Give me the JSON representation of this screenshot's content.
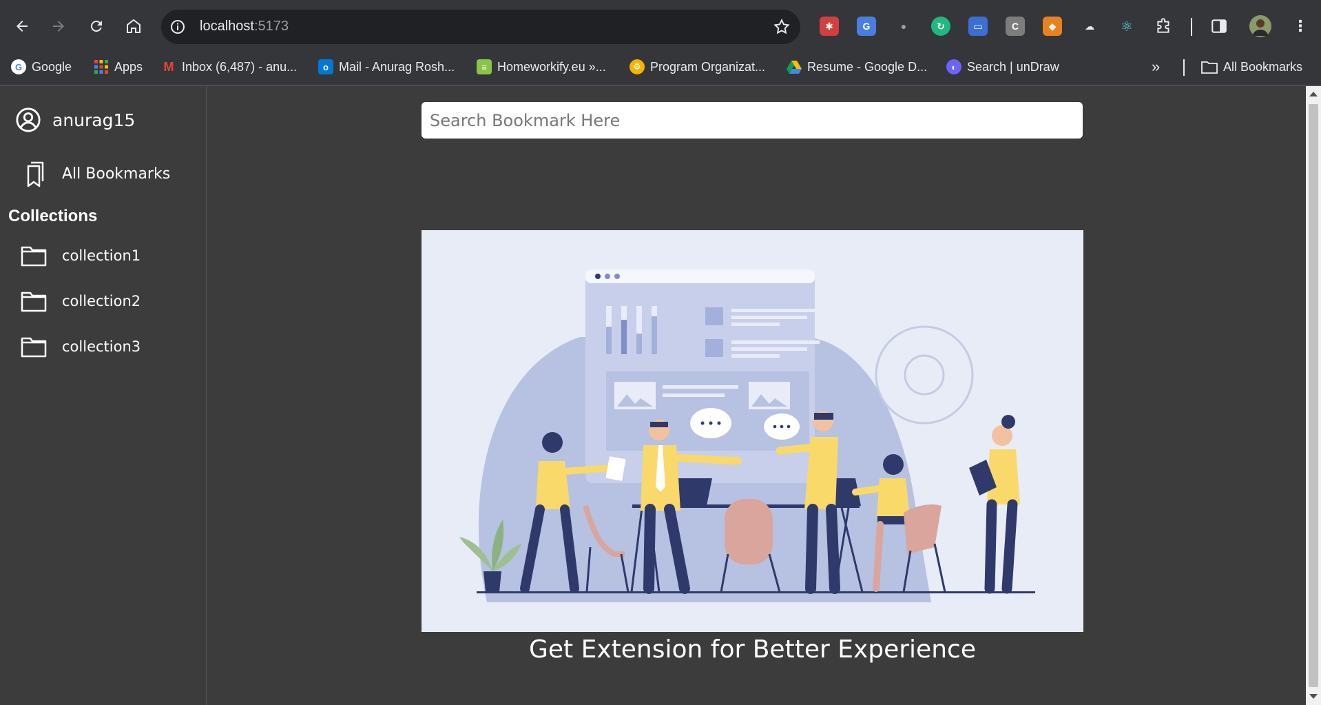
{
  "browser": {
    "url_host": "localhost",
    "url_port": ":5173",
    "bookmarks": [
      {
        "label": "Google",
        "icon": "google-icon",
        "color": "#4285f4"
      },
      {
        "label": "Apps",
        "icon": "apps-grid-icon",
        "color": "#ea4335"
      },
      {
        "label": "Inbox (6,487) - anu...",
        "icon": "gmail-icon",
        "color": "#ea4335"
      },
      {
        "label": "Mail - Anurag Rosh...",
        "icon": "outlook-icon",
        "color": "#0078d4"
      },
      {
        "label": "Homeworkify.eu »...",
        "icon": "books-icon",
        "color": "#8bc34a"
      },
      {
        "label": "Program Organizat...",
        "icon": "gear-badge-icon",
        "color": "#f4b400"
      },
      {
        "label": "Resume - Google D...",
        "icon": "google-drive-icon",
        "color": "#0f9d58"
      },
      {
        "label": "Search | unDraw",
        "icon": "undraw-icon",
        "color": "#6c63ff"
      }
    ],
    "all_bookmarks_label": "All Bookmarks"
  },
  "sidebar": {
    "username": "anurag15",
    "all_bookmarks": "All Bookmarks",
    "collections_heading": "Collections",
    "collections": [
      {
        "label": "collection1"
      },
      {
        "label": "collection2"
      },
      {
        "label": "collection3"
      }
    ]
  },
  "main": {
    "search_placeholder": "Search Bookmark Here",
    "cta": "Get Extension for Better Experience"
  },
  "colors": {
    "app_bg": "#3c3c3c",
    "illustration_bg": "#e8ecf6",
    "accent_yellow": "#f9d96a",
    "accent_navy": "#2f3a6b"
  }
}
